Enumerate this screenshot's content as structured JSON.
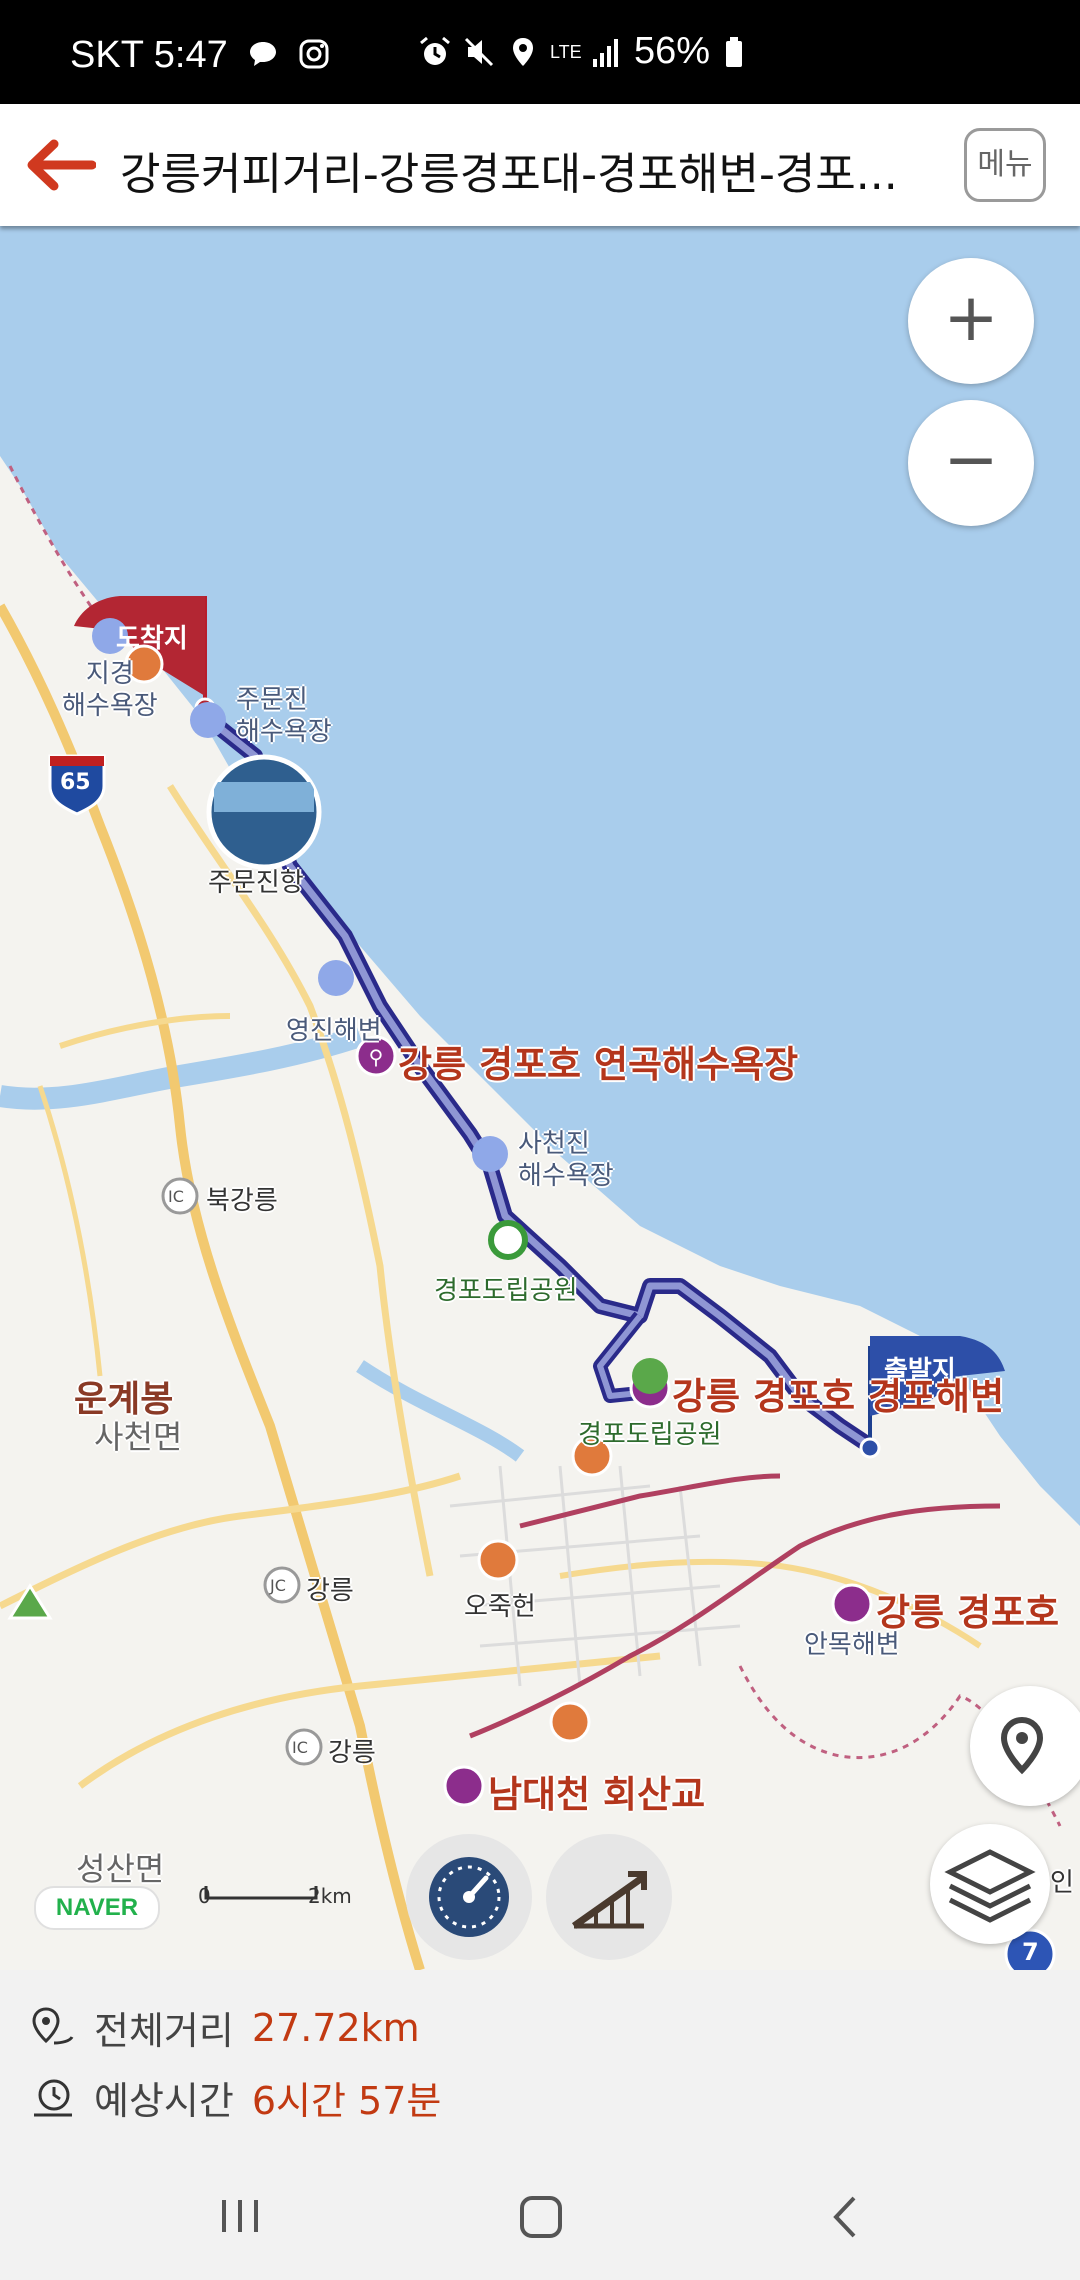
{
  "status_bar": {
    "carrier_time": "SKT 5:47",
    "network": "LTE",
    "battery": "56%"
  },
  "header": {
    "title": "강릉커피거리-강릉경포대-경포해변-경포...",
    "menu_label": "메뉴"
  },
  "map": {
    "route_color": "#2a2a8a",
    "flags": {
      "arrival": "도착지",
      "departure": "출발지"
    },
    "poi_labels": {
      "yeongok": "강릉 경포호 연곡해수욕장",
      "gyeongpo_beach": "강릉 경포호 경포해변",
      "anmok_partial": "강릉 경포호 ",
      "namdaecheon": "남대천 회산교"
    },
    "place_labels": {
      "jigyeong": "지경\n해수욕장",
      "jumunjin_beach": "주문진\n해수욕장",
      "jumunjin_port": "주문진항",
      "yeongjin": "영진해변",
      "sacheonjin": "사천진\n해수욕장",
      "gyeongpo_park": "경포도립공원",
      "gyeongpo_park2": "경포도립공원",
      "ojukheon": "오죽헌",
      "anmok": "안목해변",
      "unye_mtn": "운계봉",
      "sacheon_myeon": "사천면",
      "seongsan_myeon": "성산면",
      "buk_gangneung": "북강릉",
      "gangneung_jc": "강릉",
      "gangneung_ic": "강릉",
      "east_partial": "인"
    },
    "road_shields": {
      "expressway": "65",
      "national": "7",
      "ic": "IC",
      "jc": "JC"
    },
    "scale": {
      "zero": "0",
      "distance": "2km"
    },
    "provider_logo": "NAVER",
    "controls": {
      "zoom_in": "+",
      "zoom_out": "−"
    }
  },
  "summary": {
    "distance_label": "전체거리",
    "distance_value": "27.72km",
    "time_label": "예상시간",
    "time_value": "6시간 57분"
  }
}
